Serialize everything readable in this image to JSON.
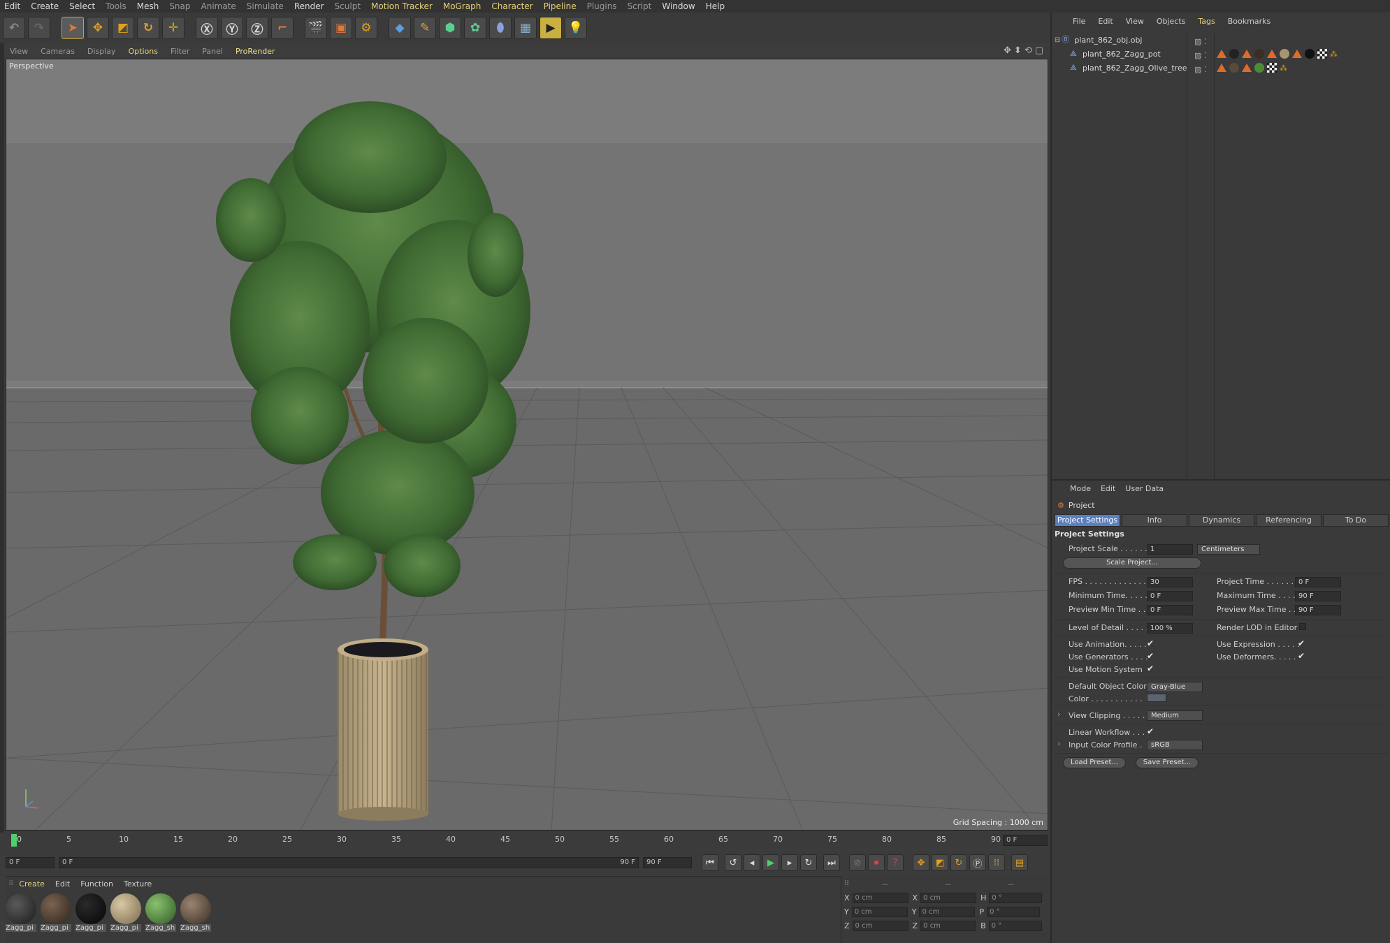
{
  "menubar": [
    "Edit",
    "Create",
    "Select",
    "Tools",
    "Mesh",
    "Snap",
    "Animate",
    "Simulate",
    "Render",
    "Sculpt",
    "Motion Tracker",
    "MoGraph",
    "Character",
    "Pipeline",
    "Plugins",
    "Script",
    "Window",
    "Help"
  ],
  "viewport": {
    "menu": [
      "View",
      "Cameras",
      "Display",
      "Options",
      "Filter",
      "Panel",
      "ProRender"
    ],
    "label": "Perspective",
    "grid_spacing": "Grid Spacing : 1000 cm"
  },
  "timeline": {
    "ticks": [
      "0",
      "5",
      "10",
      "15",
      "20",
      "25",
      "30",
      "35",
      "40",
      "45",
      "50",
      "55",
      "60",
      "65",
      "70",
      "75",
      "80",
      "85",
      "90"
    ],
    "current": "0 F"
  },
  "transport": {
    "start": "0 F",
    "range_start": "0 F",
    "range_end": "90 F",
    "end": "90 F"
  },
  "materials": {
    "menu": [
      "Create",
      "Edit",
      "Function",
      "Texture"
    ],
    "items": [
      "Zagg_pi",
      "Zagg_pi",
      "Zagg_pi",
      "Zagg_pi",
      "Zagg_sh",
      "Zagg_sh"
    ],
    "colors": [
      "#2a2a2a",
      "#4a3a2c",
      "#0e0e0e",
      "#a89472",
      "#4f8a3c",
      "#6a5444"
    ]
  },
  "coordinates": {
    "headers": [
      "--",
      "--",
      "--"
    ],
    "rows": [
      {
        "a": "X",
        "av": "0 cm",
        "b": "X",
        "bv": "0 cm",
        "c": "H",
        "cv": "0 °"
      },
      {
        "a": "Y",
        "av": "0 cm",
        "b": "Y",
        "bv": "0 cm",
        "c": "P",
        "cv": "0 °"
      },
      {
        "a": "Z",
        "av": "0 cm",
        "b": "Z",
        "bv": "0 cm",
        "c": "B",
        "cv": "0 °"
      }
    ]
  },
  "objects": {
    "menu": [
      "File",
      "Edit",
      "View",
      "Objects",
      "Tags",
      "Bookmarks"
    ],
    "items": [
      "plant_862_obj.obj",
      "plant_862_Zagg_pot",
      "plant_862_Zagg_Olive_tree"
    ]
  },
  "attributes": {
    "menu": [
      "Mode",
      "Edit",
      "User Data"
    ],
    "title": "Project",
    "tabs": [
      "Project Settings",
      "Info",
      "Dynamics",
      "Referencing",
      "To Do"
    ],
    "section": "Project Settings",
    "project_scale_label": "Project Scale . . . . . .",
    "project_scale": "1",
    "scale_unit": "Centimeters",
    "scale_project_btn": "Scale Project...",
    "fps_label": "FPS . . . . . . . . . . . . . .",
    "fps": "30",
    "project_time_label": "Project Time . . . . . . . .",
    "project_time": "0 F",
    "min_time_label": "Minimum Time. . . . .",
    "min_time": "0 F",
    "max_time_label": "Maximum Time . . . . .",
    "max_time": "90 F",
    "prev_min_label": "Preview Min Time . .",
    "prev_min": "0 F",
    "prev_max_label": "Preview Max Time . .",
    "prev_max": "90 F",
    "lod_label": "Level of Detail . . . . .",
    "lod": "100 %",
    "render_lod_label": "Render LOD in Editor",
    "use_anim_label": "Use Animation. . . . .",
    "use_expr_label": "Use Expression . . . . .",
    "use_gen_label": "Use Generators . . . .",
    "use_deform_label": "Use Deformers. . . . .",
    "use_motion_label": "Use Motion System",
    "def_color_label": "Default Object Color",
    "def_color": "Gray-Blue",
    "color_label": "Color . . . . . . . . . . .",
    "view_clip_label": "View Clipping . . . . .",
    "view_clip": "Medium",
    "linear_label": "Linear Workflow . . .",
    "icp_label": "Input Color Profile .",
    "icp": "sRGB",
    "load_preset": "Load Preset...",
    "save_preset": "Save Preset..."
  }
}
